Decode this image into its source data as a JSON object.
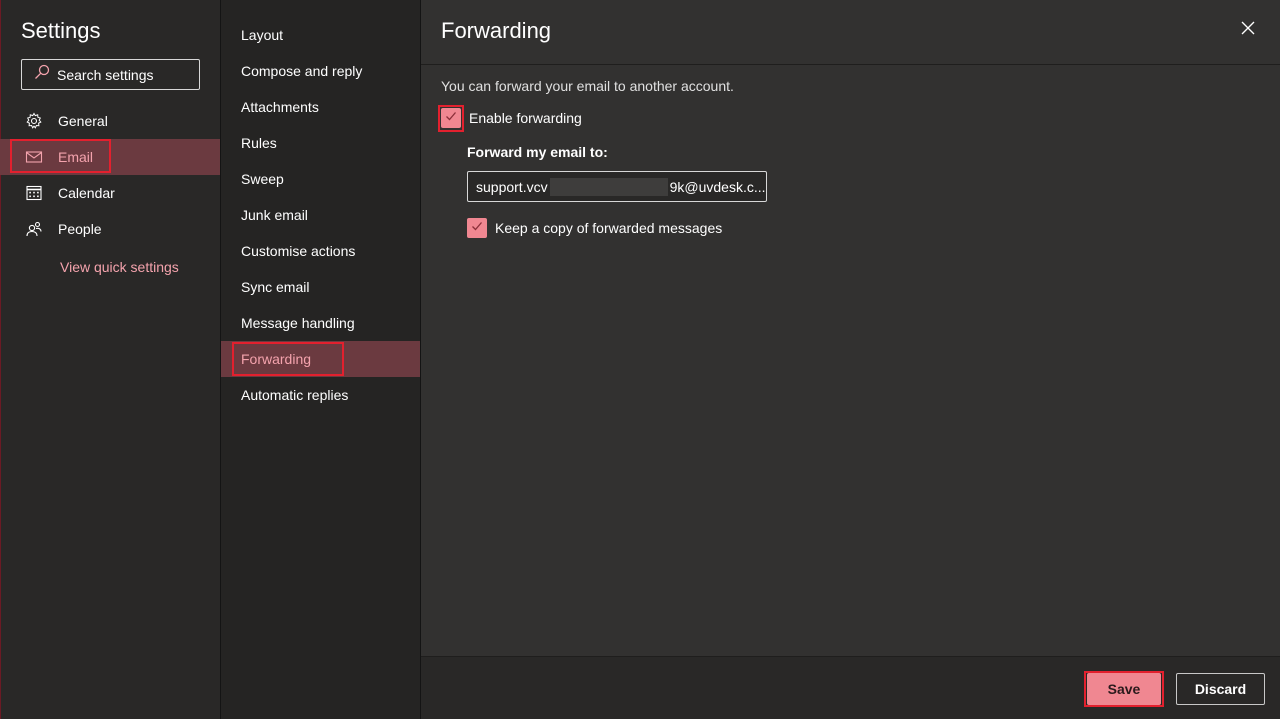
{
  "sidebar": {
    "title": "Settings",
    "search_placeholder": "Search settings",
    "items": [
      {
        "label": "General",
        "icon": "gear-icon"
      },
      {
        "label": "Email",
        "icon": "mail-icon",
        "selected": true
      },
      {
        "label": "Calendar",
        "icon": "calendar-icon"
      },
      {
        "label": "People",
        "icon": "people-icon"
      }
    ],
    "quick_settings_link": "View quick settings"
  },
  "submenu": {
    "items": [
      {
        "label": "Layout"
      },
      {
        "label": "Compose and reply"
      },
      {
        "label": "Attachments"
      },
      {
        "label": "Rules"
      },
      {
        "label": "Sweep"
      },
      {
        "label": "Junk email"
      },
      {
        "label": "Customise actions"
      },
      {
        "label": "Sync email"
      },
      {
        "label": "Message handling"
      },
      {
        "label": "Forwarding",
        "selected": true
      },
      {
        "label": "Automatic replies"
      }
    ]
  },
  "panel": {
    "title": "Forwarding",
    "description": "You can forward your email to another account.",
    "enable_forwarding_label": "Enable forwarding",
    "enable_forwarding_checked": true,
    "forward_to_label": "Forward my email to:",
    "forward_to_value_start": "support.vcv",
    "forward_to_value_end": "9k@uvdesk.c...",
    "keep_copy_label": "Keep a copy of forwarded messages",
    "keep_copy_checked": true
  },
  "footer": {
    "save_label": "Save",
    "discard_label": "Discard"
  },
  "colors": {
    "accent": "#f08791",
    "selected_bg": "#6b3a40",
    "selected_text": "#f4a3ad",
    "highlight_border": "#e3202e"
  }
}
